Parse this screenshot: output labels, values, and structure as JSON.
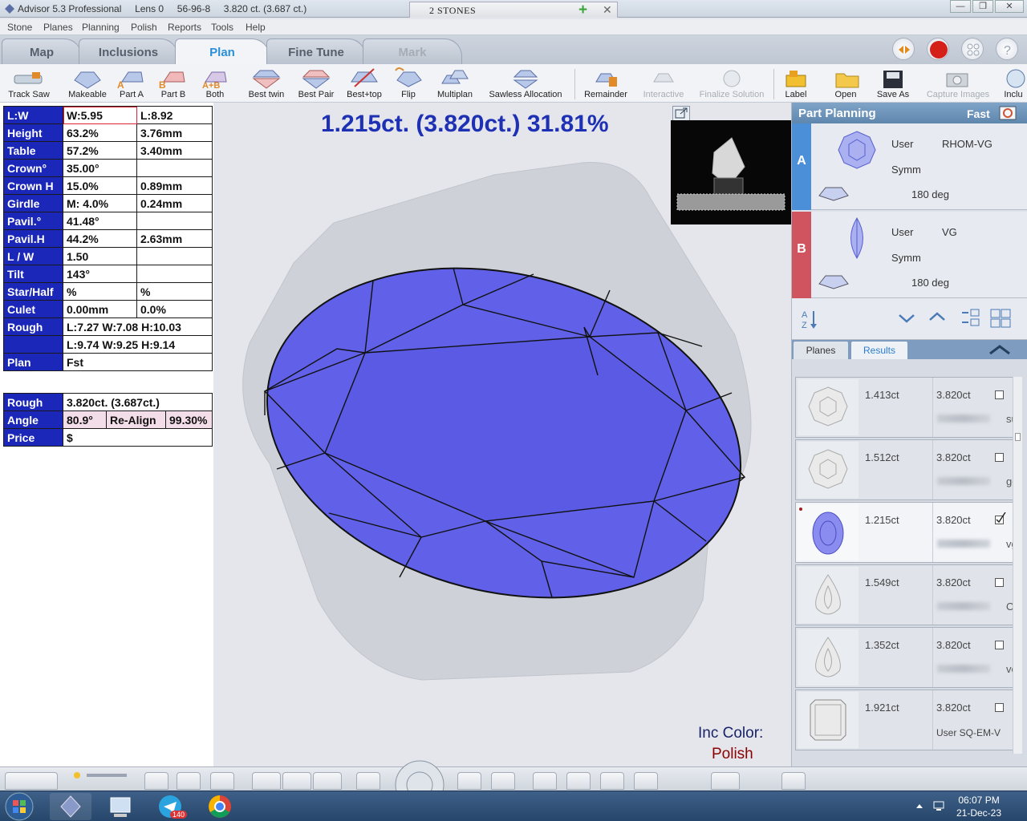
{
  "window": {
    "title": "Advisor 5.3 Professional     Lens 0     56-96-8     3.820 ct. (3.687 ct.)",
    "doc_tab": "2 STONES"
  },
  "menu": [
    "Stone",
    "Planes",
    "Planning",
    "Polish",
    "Reports",
    "Tools",
    "Help"
  ],
  "main_tabs": [
    "Map",
    "Inclusions",
    "Plan",
    "Fine Tune",
    "Mark"
  ],
  "toolbar": [
    "Track Saw",
    "Makeable",
    "Part A",
    "Part B",
    "Both",
    "Best twin",
    "Best Pair",
    "Best+top",
    "Flip",
    "Multiplan",
    "Sawless Allocation",
    "Remainder",
    "Interactive",
    "Finalize Solution",
    "Label",
    "Open",
    "Save As",
    "Capture Images",
    "Inclu"
  ],
  "params": {
    "lw_label": "L:W",
    "w": "W:5.95",
    "l": "L:8.92",
    "rows": [
      {
        "label": "Height",
        "v1": "63.2%",
        "v2": "3.76mm"
      },
      {
        "label": "Table",
        "v1": "57.2%",
        "v2": "3.40mm"
      },
      {
        "label": "Crown°",
        "v1": "35.00°",
        "v2": ""
      },
      {
        "label": "Crown H",
        "v1": "15.0%",
        "v2": "0.89mm"
      },
      {
        "label": "Girdle",
        "v1": "M: 4.0%",
        "v2": "0.24mm"
      },
      {
        "label": "Pavil.°",
        "v1": "41.48°",
        "v2": ""
      },
      {
        "label": "Pavil.H",
        "v1": "44.2%",
        "v2": "2.63mm"
      },
      {
        "label": "L / W",
        "v1": "1.50",
        "v2": ""
      },
      {
        "label": "Tilt",
        "v1": "143°",
        "v2": ""
      },
      {
        "label": "Star/Half",
        "v1": "%",
        "v2": "%"
      },
      {
        "label": "Culet",
        "v1": "0.00mm",
        "v2": "0.0%"
      }
    ],
    "rough_label": "Rough",
    "rough1": "L:7.27 W:7.08 H:10.03",
    "rough2": "L:9.74 W:9.25 H:9.14",
    "plan_label": "Plan",
    "plan_val": "Fst"
  },
  "summary": {
    "rough_label": "Rough",
    "rough_val": "3.820ct. (3.687ct.)",
    "angle_label": "Angle",
    "angle_val": "80.9°",
    "realign_label": "Re-Align",
    "realign_val": "99.30%",
    "price_label": "Price",
    "price_val": "$"
  },
  "headline": "1.215ct. (3.820ct.) 31.81%",
  "inc_color_label": "Inc Color:",
  "inc_color_value": "Polish",
  "part_planning": {
    "title": "Part Planning",
    "mode": "Fast",
    "parts": [
      {
        "letter": "A",
        "color": "#4a8fd8",
        "user": "User",
        "grade": "RHOM-VG",
        "symm": "Symm",
        "deg": "180 deg"
      },
      {
        "letter": "B",
        "color": "#d0545f",
        "user": "User",
        "grade": "VG",
        "symm": "Symm",
        "deg": "180 deg"
      }
    ]
  },
  "sub_tabs": [
    "Planes",
    "Results"
  ],
  "results": [
    {
      "ct": "1.413ct",
      "rough": "3.820ct",
      "suffix": "su",
      "checked": false,
      "shape": "round"
    },
    {
      "ct": "1.512ct",
      "rough": "3.820ct",
      "suffix": "gc",
      "checked": false,
      "shape": "round"
    },
    {
      "ct": "1.215ct",
      "rough": "3.820ct",
      "suffix": "vg",
      "checked": true,
      "shape": "oval"
    },
    {
      "ct": "1.549ct",
      "rough": "3.820ct",
      "suffix": "Ol",
      "checked": false,
      "shape": "pear"
    },
    {
      "ct": "1.352ct",
      "rough": "3.820ct",
      "suffix": "ve",
      "checked": false,
      "shape": "pear"
    },
    {
      "ct": "1.921ct",
      "rough": "3.820ct",
      "suffix": "",
      "label": "User SQ-EM-V",
      "checked": false,
      "shape": "emerald"
    }
  ],
  "taskbar": {
    "time": "06:07 PM",
    "date": "21-Dec-23",
    "badge": "140"
  }
}
